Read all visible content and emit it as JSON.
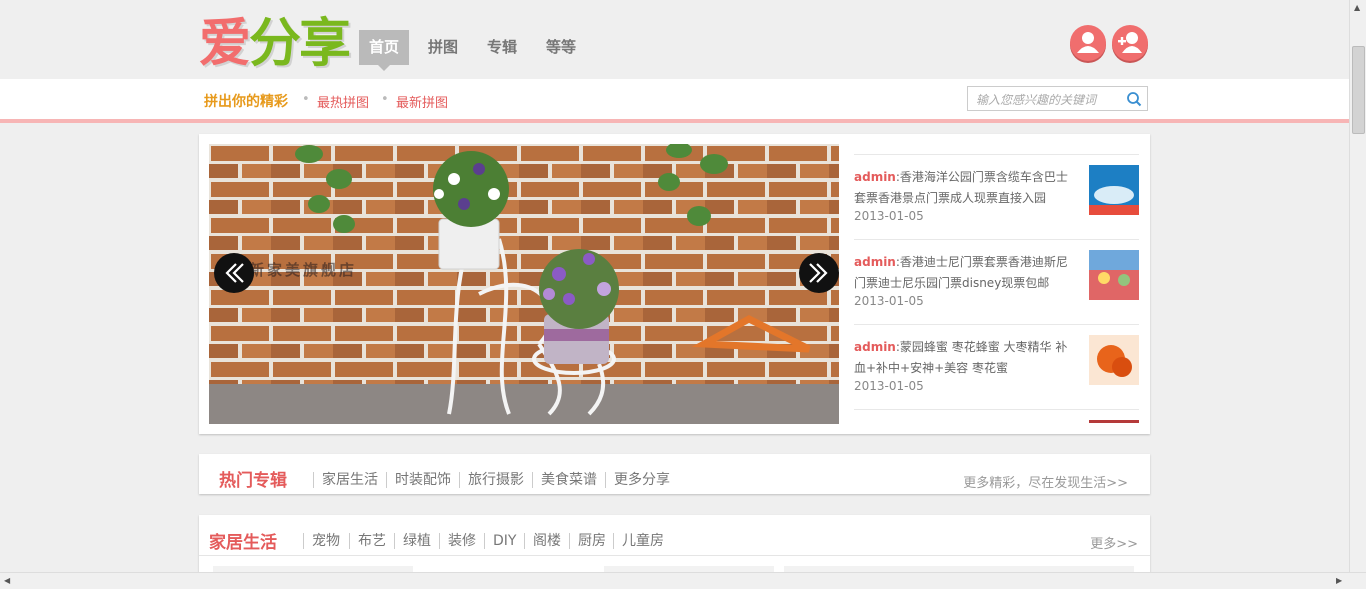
{
  "logo": [
    "爱",
    "分",
    "享"
  ],
  "logo_colors": [
    "#f26d6d",
    "#7ab81e",
    "#7ab81e"
  ],
  "nav": [
    {
      "label": "首页",
      "active": true
    },
    {
      "label": "拼图",
      "active": false
    },
    {
      "label": "专辑",
      "active": false
    },
    {
      "label": "等等",
      "active": false
    }
  ],
  "subnav": {
    "slogan": "拼出你的精彩",
    "links": [
      "最热拼图",
      "最新拼图"
    ],
    "search_placeholder": "输入您感兴趣的关键词"
  },
  "news": [
    {
      "user": "admin",
      "text": ":香港海洋公园门票含缆车含巴士套票香港景点门票成人现票直接入园",
      "date": "2013-01-05"
    },
    {
      "user": "admin",
      "text": ":香港迪士尼门票套票香港迪斯尼门票迪士尼乐园门票disney现票包邮",
      "date": "2013-01-05"
    },
    {
      "user": "admin",
      "text": ":蒙园蜂蜜 枣花蜂蜜 大枣精华 补血+补中+安神+美容 枣花蜜",
      "date": "2013-01-05"
    }
  ],
  "slide_watermark": "新家美旗舰店",
  "hot": {
    "title": "热门专辑",
    "tags": [
      "家居生活",
      "时装配饰",
      "旅行摄影",
      "美食菜谱",
      "更多分享"
    ],
    "more": "更多精彩，尽在发现生活>>"
  },
  "home": {
    "title": "家居生活",
    "tags": [
      "宠物",
      "布艺",
      "绿植",
      "装修",
      "DIY",
      "阁楼",
      "厨房",
      "儿童房"
    ],
    "more": "更多>>"
  },
  "colors": {
    "accent": "#e45b5b",
    "slogan": "#e79a1c",
    "nav_active": "#bababa"
  }
}
